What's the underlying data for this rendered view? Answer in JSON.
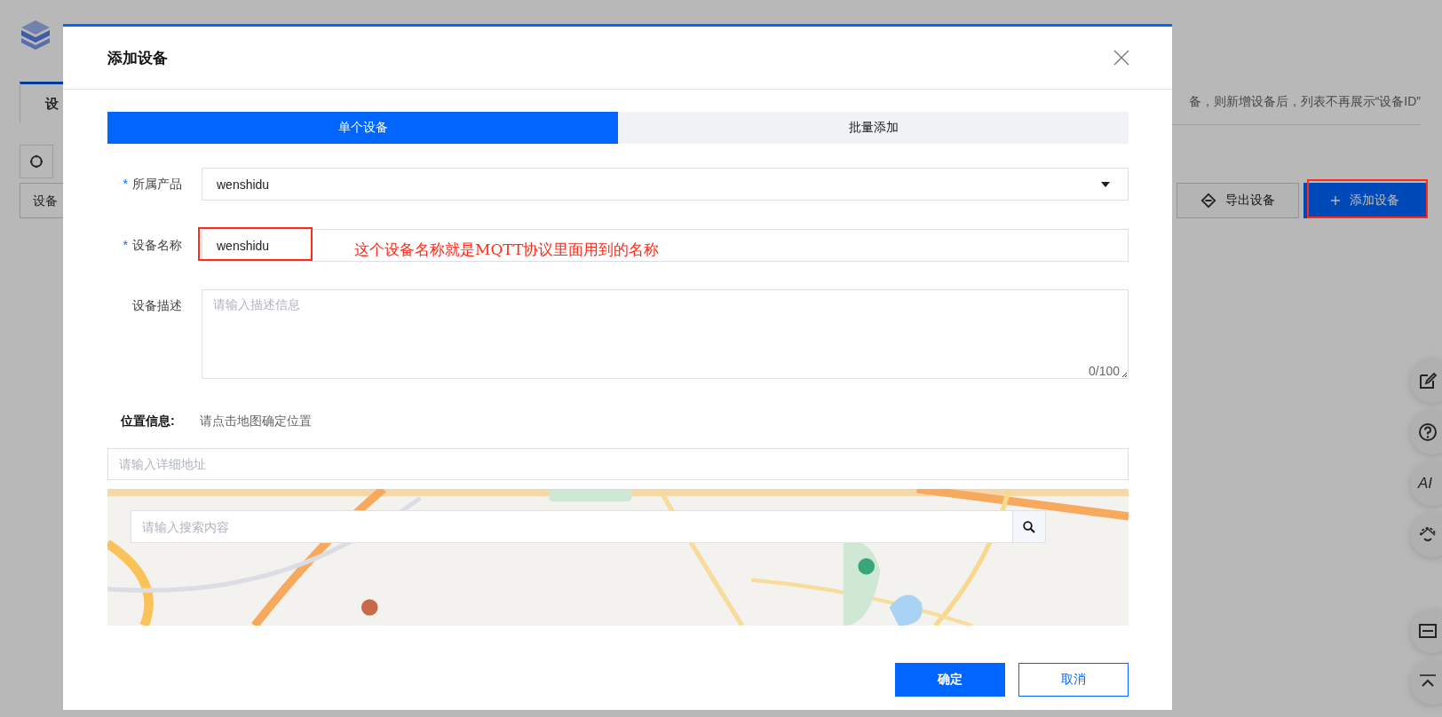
{
  "background_page": {
    "tab": "设",
    "notice": "备，则新增设备后，列表不再展示“设备ID”",
    "filter_field": {
      "value": "设备"
    },
    "buttons": [
      {
        "label": "导出设备",
        "kind": "export"
      },
      {
        "label": "添加设备",
        "kind": "add"
      }
    ],
    "float_tools": [
      {
        "kind": "edit"
      },
      {
        "kind": "help"
      },
      {
        "kind": "text",
        "label": "AI"
      },
      {
        "kind": "robot"
      },
      {
        "kind": "collapse"
      },
      {
        "kind": "top"
      }
    ]
  },
  "dialog": {
    "title": "添加设备",
    "tabs": [
      {
        "label": "单个设备",
        "selected": true
      },
      {
        "label": "批量添加",
        "selected": false
      }
    ],
    "fields": [
      {
        "label": "所属产品",
        "required_mark": "*",
        "kind": "select",
        "value": "wenshidu"
      },
      {
        "label": "设备名称",
        "required_mark": "*",
        "kind": "text",
        "value": "wenshidu"
      },
      {
        "label": "设备描述",
        "kind": "textarea",
        "placeholder": "请输入描述信息",
        "counter": "0/100"
      }
    ],
    "location": {
      "label": "位置信息:",
      "hint": "请点击地图确定位置",
      "address": {
        "placeholder": "请输入详细地址"
      },
      "map": {
        "kind": "picture",
        "search": {
          "placeholder": "请输入搜索内容"
        }
      }
    },
    "buttons": [
      {
        "label": "确定",
        "primary": true
      },
      {
        "label": "取消",
        "primary": false
      }
    ]
  },
  "annotation": {
    "text": "这个设备名称就是MQTT协议里面用到的名称"
  }
}
